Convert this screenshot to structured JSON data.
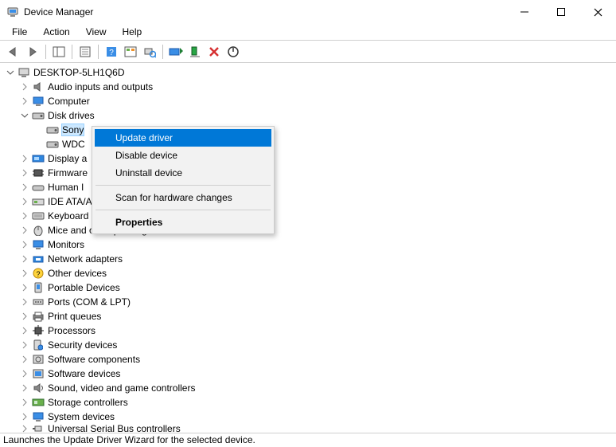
{
  "window": {
    "title": "Device Manager"
  },
  "menu": {
    "file": "File",
    "action": "Action",
    "view": "View",
    "help": "Help"
  },
  "tree": {
    "root": "DESKTOP-5LH1Q6D",
    "audio": "Audio inputs and outputs",
    "computer": "Computer",
    "disk_drives": "Disk drives",
    "sony": "Sony",
    "wdc": "WDC",
    "display": "Display a",
    "firmware": "Firmware",
    "hid": "Human I",
    "ide": "IDE ATA/A",
    "keyboards": "Keyboard",
    "mice": "Mice and other pointing devices",
    "monitors": "Monitors",
    "network": "Network adapters",
    "other": "Other devices",
    "portable": "Portable Devices",
    "ports": "Ports (COM & LPT)",
    "printq": "Print queues",
    "processors": "Processors",
    "security": "Security devices",
    "swcomp": "Software components",
    "swdev": "Software devices",
    "sound": "Sound, video and game controllers",
    "storage": "Storage controllers",
    "system": "System devices",
    "usb": "Universal Serial Bus controllers"
  },
  "context_menu": {
    "update_driver": "Update driver",
    "disable": "Disable device",
    "uninstall": "Uninstall device",
    "scan": "Scan for hardware changes",
    "properties": "Properties"
  },
  "status": "Launches the Update Driver Wizard for the selected device."
}
